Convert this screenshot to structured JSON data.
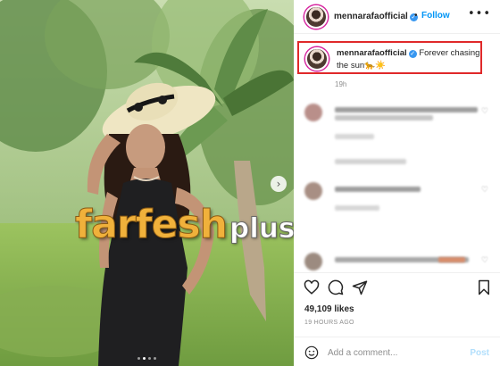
{
  "post": {
    "username": "mennarafaofficial",
    "follow_label": "Follow",
    "separator": "•",
    "more_label": "•••",
    "caption_text": "Forever chasing the sun",
    "caption_emojis": "🐆☀️",
    "caption_time": "19h",
    "likes": "49,109 likes",
    "posted_ago": "19 HOURS AGO",
    "add_comment_placeholder": "Add a comment...",
    "post_label": "Post",
    "next_arrow": "›"
  },
  "watermark": {
    "main": "farfesh",
    "sub": "plus.com"
  },
  "icons": {
    "like": "heart-icon",
    "comment": "comment-icon",
    "share": "paper-plane-icon",
    "save": "bookmark-icon",
    "emoji": "smiley-icon"
  },
  "colors": {
    "accent": "#0095f6",
    "highlight_box": "#e0292a",
    "verified": "#3897f0",
    "watermark_gold": "#f0b13b"
  },
  "carousel": {
    "current_slide": 2,
    "total_slides": 4
  }
}
